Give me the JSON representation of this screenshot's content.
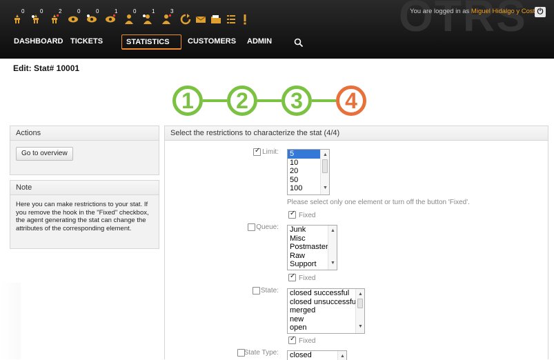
{
  "header": {
    "logo_text": "OTRS",
    "login_text": "You are logged in as",
    "user_name": "Miguel Hidalgo y Costilla",
    "toolbar": [
      {
        "icon": "ticket-locked-icon",
        "count": "0"
      },
      {
        "icon": "ticket-locked-new-icon",
        "count": "0"
      },
      {
        "icon": "ticket-locked-reminder-icon",
        "count": "2"
      },
      {
        "icon": "ticket-watched-icon",
        "count": "0"
      },
      {
        "icon": "ticket-watched-new-icon",
        "count": "0"
      },
      {
        "icon": "ticket-watched-reminder-icon",
        "count": "1"
      },
      {
        "icon": "ticket-responsible-icon",
        "count": "0"
      },
      {
        "icon": "ticket-responsible-new-icon",
        "count": "1"
      },
      {
        "icon": "ticket-responsible-reminder-icon",
        "count": "3"
      },
      {
        "icon": "refresh-icon",
        "count": ""
      },
      {
        "icon": "email-icon",
        "count": ""
      },
      {
        "icon": "folder-icon",
        "count": ""
      },
      {
        "icon": "list-icon",
        "count": ""
      },
      {
        "icon": "alert-icon",
        "count": ""
      }
    ],
    "nav": [
      "DASHBOARD",
      "TICKETS",
      "STATISTICS",
      "CUSTOMERS",
      "ADMIN"
    ],
    "nav_selected": "STATISTICS"
  },
  "page": {
    "title": "Edit: Stat# 10001",
    "steps": [
      "1",
      "2",
      "3",
      "4"
    ],
    "active_step": "4"
  },
  "sidebar": {
    "actions_title": "Actions",
    "go_button": "Go to overview",
    "note_title": "Note",
    "note_text": "Here you can make restrictions to your stat. If you remove the hook in the \"Fixed\" checkbox, the agent generating the stat can change the attributes of the corresponding element."
  },
  "main": {
    "title": "Select the restrictions to characterize the stat (4/4)",
    "fixed_label": "Fixed",
    "limit": {
      "label": "Limit:",
      "checked": true,
      "options": [
        "5",
        "10",
        "20",
        "50",
        "100"
      ],
      "selected": "5",
      "hint": "Please select only one element or turn off the button 'Fixed'.",
      "fixed": true
    },
    "queue": {
      "label": "Queue:",
      "checked": false,
      "options": [
        "Junk",
        "Misc",
        "Postmaster",
        "Raw",
        "Support"
      ],
      "fixed": true
    },
    "state": {
      "label": "State:",
      "checked": false,
      "options": [
        "closed successful",
        "closed unsuccessful",
        "merged",
        "new",
        "open"
      ],
      "fixed": true
    },
    "state_type": {
      "label": "State Type:",
      "checked": false,
      "options": [
        "closed"
      ]
    }
  },
  "colors": {
    "step_done": "#7bc142",
    "step_active": "#e8703a",
    "nav_selected_border": "#f08c2a",
    "user_link": "#f0a020"
  }
}
